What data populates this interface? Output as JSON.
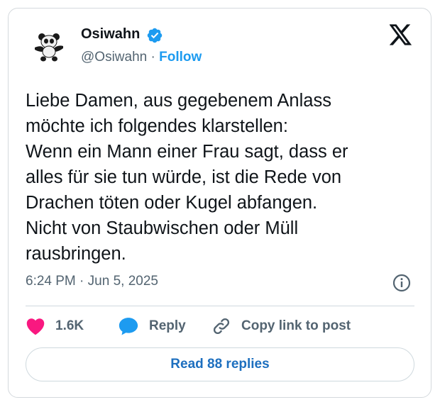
{
  "author": {
    "display_name": "Osiwahn",
    "handle": "@Osiwahn",
    "separator": "·",
    "follow_label": "Follow"
  },
  "tweet": {
    "lines": [
      "Liebe Damen, aus gegebenem Anlass",
      "möchte ich folgendes klarstellen:",
      "Wenn ein Mann einer Frau sagt, dass er",
      "alles für sie tun würde, ist die Rede von",
      "Drachen töten oder Kugel abfangen.",
      "Nicht von Staubwischen oder Müll",
      "rausbringen."
    ],
    "time": "6:24 PM",
    "date": "Jun 5, 2025",
    "meta_separator": "·"
  },
  "actions": {
    "like_count": "1.6K",
    "reply_label": "Reply",
    "copy_label": "Copy link to post"
  },
  "footer": {
    "read_replies_label": "Read 88 replies"
  },
  "icons": {
    "avatar": "panda-avatar-icon",
    "verified": "verified-badge-icon",
    "logo": "x-logo-icon",
    "info": "info-icon",
    "like": "heart-icon",
    "reply": "reply-bubble-icon",
    "copy": "link-icon"
  },
  "colors": {
    "accent": "#1d9bf0",
    "like": "#f91880",
    "text": "#0f1419",
    "muted": "#536471",
    "border": "#cfd9de"
  }
}
